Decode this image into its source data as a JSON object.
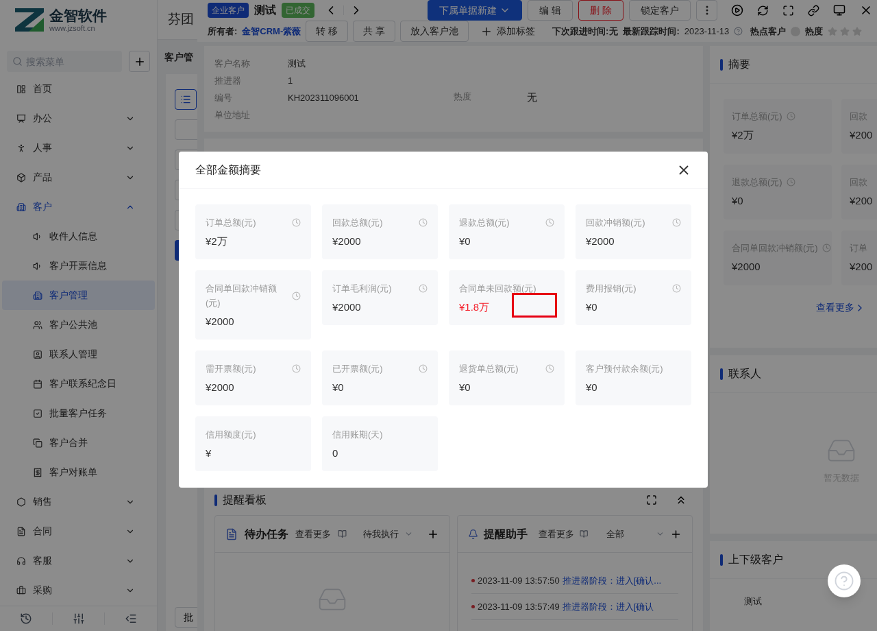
{
  "sidebar": {
    "logo": {
      "name": "金智软件",
      "url": "www.jzsoft.cn"
    },
    "search": {
      "placeholder": "搜索菜单"
    },
    "items": [
      {
        "label": "首页",
        "kind": "link"
      },
      {
        "label": "办公",
        "kind": "group",
        "expanded": false
      },
      {
        "label": "人事",
        "kind": "group",
        "expanded": false
      },
      {
        "label": "产品",
        "kind": "group",
        "expanded": false
      },
      {
        "label": "客户",
        "kind": "group",
        "expanded": true,
        "children": [
          {
            "label": "收件人信息",
            "selected": false
          },
          {
            "label": "客户开票信息",
            "selected": false
          },
          {
            "label": "客户管理",
            "selected": true
          },
          {
            "label": "客户公共池",
            "selected": false
          },
          {
            "label": "联系人管理",
            "selected": false
          },
          {
            "label": "客户联系纪念日",
            "selected": false
          },
          {
            "label": "批量客户任务",
            "selected": false
          },
          {
            "label": "客户合并",
            "selected": false
          },
          {
            "label": "客户对账单",
            "selected": false
          }
        ]
      },
      {
        "label": "销售",
        "kind": "group",
        "expanded": false
      },
      {
        "label": "合同",
        "kind": "group",
        "expanded": false
      },
      {
        "label": "客服",
        "kind": "group",
        "expanded": false
      },
      {
        "label": "采购",
        "kind": "group",
        "expanded": false
      }
    ]
  },
  "background_page": {
    "title": "芬团",
    "section": "客户管",
    "button": "批"
  },
  "drawer": {
    "header": {
      "tag": "企业客户",
      "title": "测试",
      "status": "已成交",
      "actions": [
        {
          "label": "下属单据新建",
          "kind": "primary"
        },
        {
          "label": "编 辑",
          "kind": "default"
        },
        {
          "label": "删 除",
          "kind": "danger"
        },
        {
          "label": "锁定客户",
          "kind": "default"
        }
      ]
    },
    "owner_bar": {
      "owner_label": "所有者:",
      "owner": "金智CRM-紫薇",
      "buttons": [
        "转 移",
        "共 享",
        "放入客户池"
      ],
      "add_tag": "添加标签",
      "next_follow_label": "下次跟进时间:",
      "next_follow": "无",
      "last_track_label": "最新跟踪时间:",
      "last_track": "2023-11-13",
      "hot_label": "热点客户",
      "hot": false,
      "heat_label": "热度",
      "stars": 0
    },
    "info": {
      "rows": [
        [
          {
            "label": "客户名称",
            "value": "测试"
          }
        ],
        [
          {
            "label": "推进器",
            "value": "1"
          }
        ],
        [
          {
            "label": "编号",
            "value": "KH202311096001"
          },
          {
            "label": "热度",
            "value": "无"
          }
        ],
        [
          {
            "label": "单位地址"
          }
        ]
      ]
    },
    "summary": {
      "title": "摘要",
      "items": [
        {
          "label": "订单总额(元)",
          "value": "¥2万",
          "clock": true
        },
        {
          "label": "回款",
          "value": "¥200",
          "clock": false
        },
        {
          "label": "退款总额(元)",
          "value": "¥0",
          "clock": true
        },
        {
          "label": "回款",
          "value": "¥200",
          "clock": false
        },
        {
          "label": "合同单回款冲销额(元)",
          "value": "¥2000",
          "clock": true
        },
        {
          "label": "订单",
          "value": "¥200",
          "clock": false
        }
      ],
      "more": "查看更多"
    },
    "contacts": {
      "title": "联系人",
      "empty": "暂无数据"
    },
    "hierarchy": {
      "title": "上下级客户",
      "items": [
        "测试"
      ]
    },
    "reminders": {
      "title": "提醒看板",
      "todo": {
        "title": "待办任务",
        "more": "查看更多",
        "filter": "待我执行"
      },
      "assistant": {
        "title": "提醒助手",
        "more": "查看更多",
        "filter": "全部",
        "entries": [
          {
            "time": "2023-11-09 13:57:50",
            "text": "推进器阶段：进入[确认..."
          },
          {
            "time": "2023-11-09 13:57:49",
            "text": "推进器阶段：进入[确认"
          }
        ]
      }
    }
  },
  "modal": {
    "title": "全部金额摘要",
    "items": [
      {
        "label": "订单总额(元)",
        "value": "¥2万",
        "clock": true,
        "alert": false,
        "marked": false
      },
      {
        "label": "回款总额(元)",
        "value": "¥2000",
        "clock": true,
        "alert": false,
        "marked": false
      },
      {
        "label": "退款总额(元)",
        "value": "¥0",
        "clock": true,
        "alert": false,
        "marked": false
      },
      {
        "label": "回款冲销额(元)",
        "value": "¥2000",
        "clock": true,
        "alert": false,
        "marked": false
      },
      {
        "label": "合同单回款冲销额(元)",
        "value": "¥2000",
        "clock": true,
        "alert": false,
        "marked": false
      },
      {
        "label": "订单毛利润(元)",
        "value": "¥2000",
        "clock": true,
        "alert": false,
        "marked": false
      },
      {
        "label": "合同单未回款额(元)",
        "value": "¥1.8万",
        "clock": false,
        "alert": true,
        "marked": true
      },
      {
        "label": "费用报销(元)",
        "value": "¥0",
        "clock": true,
        "alert": false,
        "marked": false
      },
      {
        "label": "需开票额(元)",
        "value": "¥2000",
        "clock": true,
        "alert": false,
        "marked": false
      },
      {
        "label": "已开票额(元)",
        "value": "¥0",
        "clock": true,
        "alert": false,
        "marked": false
      },
      {
        "label": "退货单总额(元)",
        "value": "¥0",
        "clock": true,
        "alert": false,
        "marked": false
      },
      {
        "label": "客户预付款余额(元)",
        "value": "¥0",
        "clock": false,
        "alert": false,
        "marked": false
      },
      {
        "label": "信用额度(元)",
        "value": "¥",
        "clock": false,
        "alert": false,
        "marked": false
      },
      {
        "label": "信用账期(天)",
        "value": "0",
        "clock": false,
        "alert": false,
        "marked": false
      }
    ]
  }
}
